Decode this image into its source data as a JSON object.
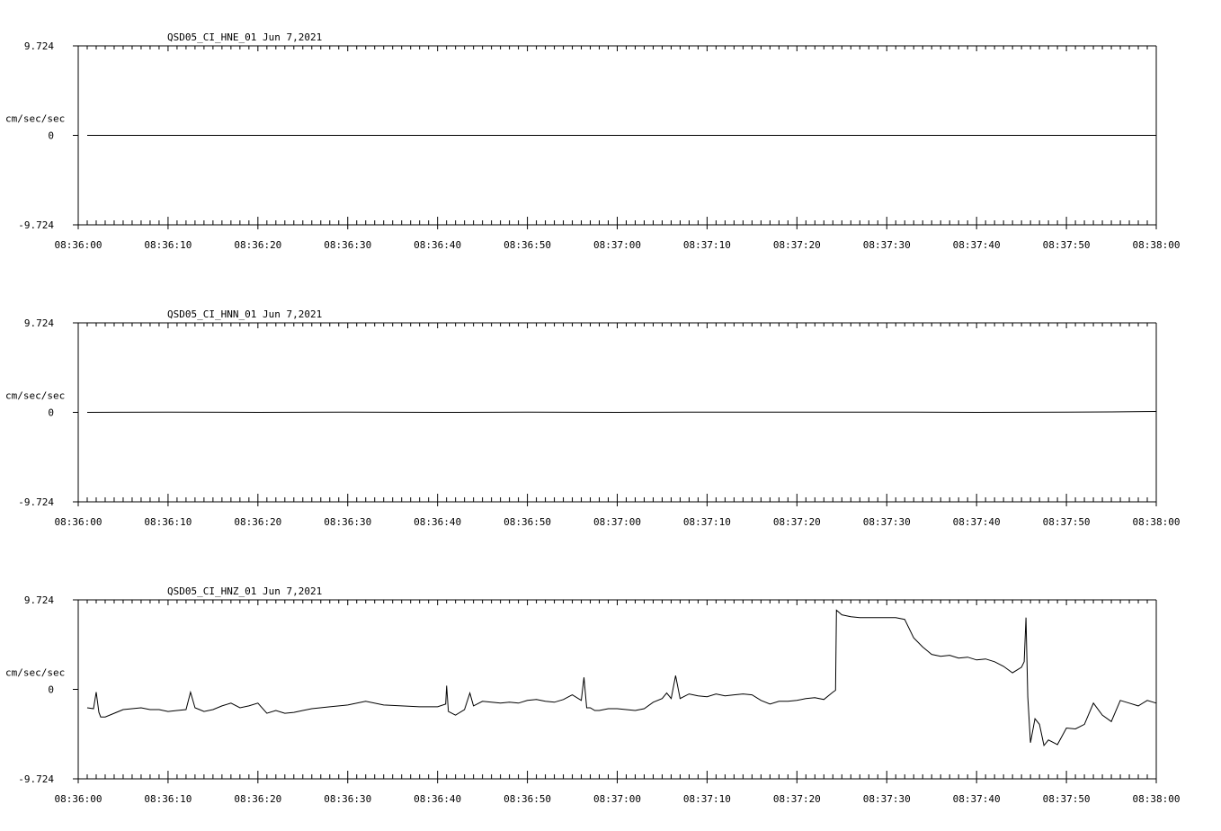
{
  "chart_data": [
    {
      "type": "line",
      "title": "QSD05_CI_HNE_01  Jun 7,2021",
      "ylabel": "cm/sec/sec",
      "ylim": [
        -9.724,
        9.724
      ],
      "yticks": [
        "9.724",
        "0",
        "-9.724"
      ],
      "xlim": [
        "08:36:00",
        "08:38:00"
      ],
      "xticks": [
        "08:36:00",
        "08:36:10",
        "08:36:20",
        "08:36:30",
        "08:36:40",
        "08:36:50",
        "08:37:00",
        "08:37:10",
        "08:37:20",
        "08:37:30",
        "08:37:40",
        "08:37:50",
        "08:38:00"
      ],
      "grid": false,
      "series": [
        {
          "t": [
            1,
            120
          ],
          "values": [
            0,
            0
          ]
        }
      ]
    },
    {
      "type": "line",
      "title": "QSD05_CI_HNN_01  Jun 7,2021",
      "ylabel": "cm/sec/sec",
      "ylim": [
        -9.724,
        9.724
      ],
      "yticks": [
        "9.724",
        "0",
        "-9.724"
      ],
      "xlim": [
        "08:36:00",
        "08:38:00"
      ],
      "xticks": [
        "08:36:00",
        "08:36:10",
        "08:36:20",
        "08:36:30",
        "08:36:40",
        "08:36:50",
        "08:37:00",
        "08:37:10",
        "08:37:20",
        "08:37:30",
        "08:37:40",
        "08:37:50",
        "08:38:00"
      ],
      "grid": false,
      "series": [
        {
          "t": [
            1,
            10,
            20,
            30,
            40,
            50,
            60,
            70,
            80,
            90,
            100,
            110,
            115,
            120
          ],
          "values": [
            0,
            0.02,
            0,
            0.02,
            0,
            0.02,
            0,
            0.03,
            0.02,
            0.03,
            0,
            0.02,
            0.05,
            0.1
          ]
        }
      ]
    },
    {
      "type": "line",
      "title": "QSD05_CI_HNZ_01  Jun 7,2021",
      "ylabel": "cm/sec/sec",
      "ylim": [
        -9.724,
        9.724
      ],
      "yticks": [
        "9.724",
        "0",
        "-9.724"
      ],
      "xlim": [
        "08:36:00",
        "08:38:00"
      ],
      "xticks": [
        "08:36:00",
        "08:36:10",
        "08:36:20",
        "08:36:30",
        "08:36:40",
        "08:36:50",
        "08:37:00",
        "08:37:10",
        "08:37:20",
        "08:37:30",
        "08:37:40",
        "08:37:50",
        "08:38:00"
      ],
      "grid": false,
      "series": [
        {
          "t": [
            1,
            1.7,
            2,
            2.3,
            2.5,
            3,
            4,
            5,
            6,
            7,
            8,
            9,
            10,
            11,
            12,
            12.5,
            13,
            13.5,
            14,
            15,
            16,
            17,
            18,
            19,
            20,
            21,
            22,
            23,
            24,
            25,
            26,
            28,
            30,
            32,
            34,
            36,
            38,
            40,
            40.9,
            41,
            41.2,
            42,
            43,
            43.6,
            44,
            45,
            46,
            47,
            48,
            49,
            50,
            51,
            52,
            53,
            54,
            55,
            56,
            56.3,
            56.6,
            57,
            57.5,
            58,
            59,
            60,
            61,
            62,
            63,
            64,
            65,
            65.5,
            66,
            66.5,
            67,
            68,
            69,
            70,
            71,
            72,
            73,
            74,
            75,
            76,
            77,
            78,
            79,
            80,
            81,
            82,
            83,
            84,
            84.3,
            84.4,
            85,
            86,
            87,
            88,
            89,
            90,
            91,
            92,
            93,
            94,
            94.5,
            95,
            96,
            97,
            98,
            99,
            100,
            101,
            102,
            103,
            104,
            105,
            105.3,
            105.5,
            105.7,
            106,
            106.5,
            107,
            107.5,
            108,
            109,
            110,
            111,
            112,
            113,
            114,
            115,
            116,
            117,
            118,
            119,
            120
          ],
          "values": [
            -2.0,
            -2.1,
            -0.3,
            -2.5,
            -3.0,
            -3.0,
            -2.6,
            -2.2,
            -2.1,
            -2.0,
            -2.2,
            -2.2,
            -2.4,
            -2.3,
            -2.2,
            -0.3,
            -2.0,
            -2.2,
            -2.4,
            -2.2,
            -1.8,
            -1.5,
            -2.0,
            -1.8,
            -1.5,
            -2.6,
            -2.3,
            -2.6,
            -2.5,
            -2.3,
            -2.1,
            -1.9,
            -1.7,
            -1.3,
            -1.7,
            -1.8,
            -1.9,
            -1.9,
            -1.6,
            0.4,
            -2.4,
            -2.8,
            -2.2,
            -0.4,
            -1.8,
            -1.3,
            -1.4,
            -1.5,
            -1.4,
            -1.5,
            -1.2,
            -1.1,
            -1.3,
            -1.4,
            -1.1,
            -0.6,
            -1.2,
            1.3,
            -2.0,
            -2.0,
            -2.3,
            -2.3,
            -2.1,
            -2.1,
            -2.2,
            -2.3,
            -2.1,
            -1.4,
            -1.0,
            -0.4,
            -1.0,
            1.5,
            -1.0,
            -0.5,
            -0.7,
            -0.8,
            -0.5,
            -0.7,
            -0.6,
            -0.5,
            -0.6,
            -1.2,
            -1.6,
            -1.3,
            -1.3,
            -1.2,
            -1.0,
            -0.9,
            -1.1,
            -0.3,
            -0.1,
            8.6,
            8.1,
            7.9,
            7.8,
            7.8,
            7.8,
            7.8,
            7.8,
            7.6,
            5.6,
            4.6,
            4.2,
            3.8,
            3.6,
            3.7,
            3.4,
            3.5,
            3.2,
            3.3,
            3.0,
            2.5,
            1.8,
            2.4,
            3.0,
            7.8,
            -0.8,
            -5.8,
            -3.2,
            -3.8,
            -6.1,
            -5.5,
            -6.0,
            -4.2,
            -4.3,
            -3.8,
            -1.5,
            -2.8,
            -3.5,
            -1.2,
            -1.5,
            -1.8,
            -1.2,
            -1.5,
            -2.0,
            -3.0
          ]
        }
      ]
    }
  ]
}
